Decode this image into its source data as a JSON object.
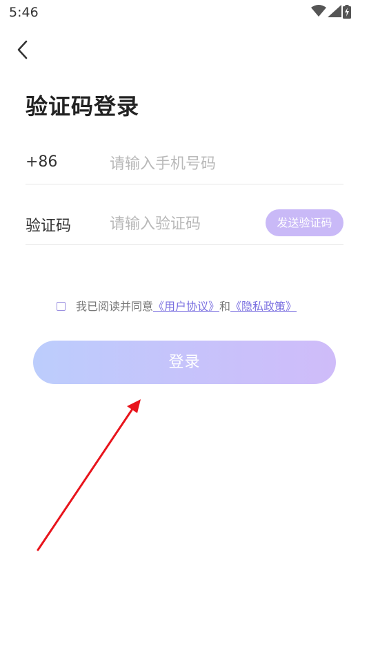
{
  "status_bar": {
    "time": "5:46",
    "icons": [
      "wifi-icon",
      "signal-icon",
      "battery-charging-icon"
    ]
  },
  "header": {
    "back_icon": "chevron-left-icon",
    "title": "验证码登录"
  },
  "phone_row": {
    "country_code": "+86",
    "placeholder": "请输入手机号码",
    "value": ""
  },
  "code_row": {
    "label": "验证码",
    "placeholder": "请输入验证码",
    "value": "",
    "send_button": "发送验证码"
  },
  "agreement": {
    "checked": false,
    "prefix": "我已阅读并同意",
    "user_agreement": "《用户协议》",
    "joiner": "和",
    "privacy_policy": "《隐私政策》"
  },
  "login_button": {
    "label": "登录"
  },
  "colors": {
    "accent": "#c9b9f7",
    "link": "#7a6fe0",
    "button_gradient_start": "#bccdfc",
    "button_gradient_end": "#cfbcf9",
    "annotation_arrow": "#e8141c"
  }
}
